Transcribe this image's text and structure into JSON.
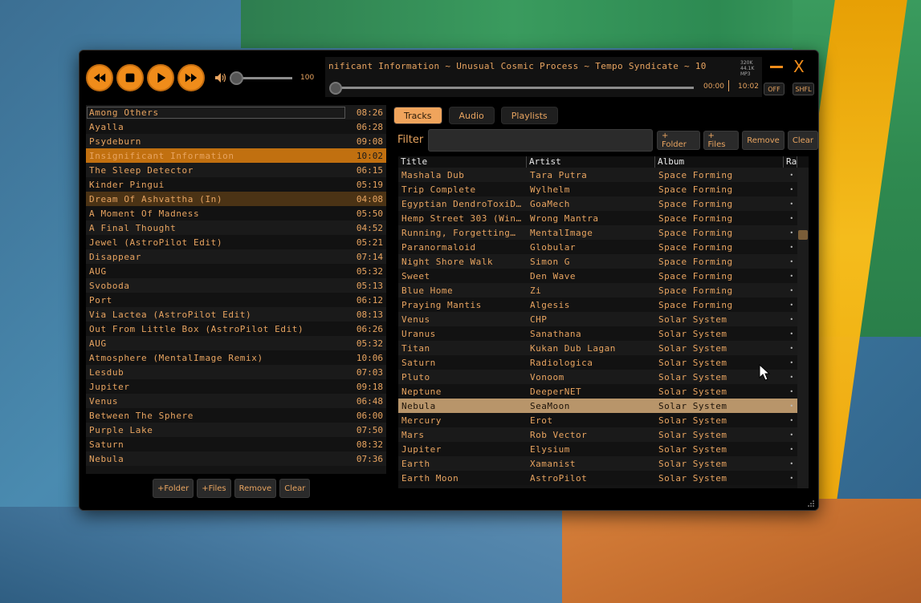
{
  "transport": {
    "volume": "100",
    "now_playing": "nificant Information  ~  Unusual Cosmic Process  ~  Tempo Syndicate  ~  10",
    "format": [
      "320K",
      "44.1K",
      "MP3"
    ],
    "time_current": "00:00",
    "time_total": "10:02",
    "repeat": "OFF",
    "shuffle": "SHFL",
    "close_glyph": "X"
  },
  "playlist": {
    "items": [
      {
        "title": "Among Others",
        "dur": "08:26"
      },
      {
        "title": "Ayalla",
        "dur": "06:28"
      },
      {
        "title": "Psydeburn",
        "dur": "09:08"
      },
      {
        "title": "Insignificant Information",
        "dur": "10:02"
      },
      {
        "title": "The Sleep Detector",
        "dur": "06:15"
      },
      {
        "title": "Kinder Pingui",
        "dur": "05:19"
      },
      {
        "title": "Dream Of Ashvattha (In)",
        "dur": "04:08"
      },
      {
        "title": "A Moment Of Madness",
        "dur": "05:50"
      },
      {
        "title": "A Final Thought",
        "dur": "04:52"
      },
      {
        "title": "Jewel (AstroPilot Edit)",
        "dur": "05:21"
      },
      {
        "title": "Disappear",
        "dur": "07:14"
      },
      {
        "title": "AUG",
        "dur": "05:32"
      },
      {
        "title": "Svoboda",
        "dur": "05:13"
      },
      {
        "title": "Port",
        "dur": "06:12"
      },
      {
        "title": "Via Lactea (AstroPilot Edit)",
        "dur": "08:13"
      },
      {
        "title": "Out From Little Box (AstroPilot Edit)",
        "dur": "06:26"
      },
      {
        "title": "AUG",
        "dur": "05:32"
      },
      {
        "title": "Atmosphere (MentalImage Remix)",
        "dur": "10:06"
      },
      {
        "title": "Lesdub",
        "dur": "07:03"
      },
      {
        "title": "Jupiter",
        "dur": "09:18"
      },
      {
        "title": "Venus",
        "dur": "06:48"
      },
      {
        "title": "Between The Sphere",
        "dur": "06:00"
      },
      {
        "title": "Purple Lake",
        "dur": "07:50"
      },
      {
        "title": "Saturn",
        "dur": "08:32"
      },
      {
        "title": "Nebula",
        "dur": "07:36"
      }
    ],
    "buttons": {
      "folder": "+Folder",
      "files": "+Files",
      "remove": "Remove",
      "clear": "Clear"
    }
  },
  "library": {
    "tabs": [
      "Tracks",
      "Audio",
      "Playlists"
    ],
    "filter_label": "Filter",
    "filter_value": "",
    "buttons": {
      "folder": "+ Folder",
      "files": "+ Files",
      "remove": "Remove",
      "clear": "Clear"
    },
    "columns": [
      "Title",
      "Artist",
      "Album",
      "Ra"
    ],
    "rows": [
      {
        "title": "Mashala Dub",
        "artist": "Tara Putra",
        "album": "Space Forming"
      },
      {
        "title": "Trip Complete",
        "artist": "Wylhelm",
        "album": "Space Forming"
      },
      {
        "title": "Egyptian DendroToxiD…",
        "artist": "GoaMech",
        "album": "Space Forming"
      },
      {
        "title": "Hemp Street 303 (Win…",
        "artist": "Wrong Mantra",
        "album": "Space Forming"
      },
      {
        "title": "Running, Forgetting…",
        "artist": "MentalImage",
        "album": "Space Forming"
      },
      {
        "title": "Paranormaloid",
        "artist": "Globular",
        "album": "Space Forming"
      },
      {
        "title": "Night Shore Walk",
        "artist": "Simon G",
        "album": "Space Forming"
      },
      {
        "title": "Sweet",
        "artist": "Den Wave",
        "album": "Space Forming"
      },
      {
        "title": "Blue Home",
        "artist": "Zi",
        "album": "Space Forming"
      },
      {
        "title": "Praying Mantis",
        "artist": "Algesis",
        "album": "Space Forming"
      },
      {
        "title": "Venus",
        "artist": "CHP",
        "album": "Solar System"
      },
      {
        "title": "Uranus",
        "artist": "Sanathana",
        "album": "Solar System"
      },
      {
        "title": "Titan",
        "artist": "Kukan Dub Lagan",
        "album": "Solar System"
      },
      {
        "title": "Saturn",
        "artist": "Radiologica",
        "album": "Solar System"
      },
      {
        "title": "Pluto",
        "artist": "Vonoom",
        "album": "Solar System"
      },
      {
        "title": "Neptune",
        "artist": "DeeperNET",
        "album": "Solar System"
      },
      {
        "title": "Nebula",
        "artist": "SeaMoon",
        "album": "Solar System"
      },
      {
        "title": "Mercury",
        "artist": "Erot",
        "album": "Solar System"
      },
      {
        "title": "Mars",
        "artist": "Rob Vector",
        "album": "Solar System"
      },
      {
        "title": "Jupiter",
        "artist": "Elysium",
        "album": "Solar System"
      },
      {
        "title": "Earth",
        "artist": "Xamanist",
        "album": "Solar System"
      },
      {
        "title": "Earth Moon",
        "artist": "AstroPilot",
        "album": "Solar System"
      }
    ],
    "rating_glyph": "•"
  },
  "colors": {
    "accent": "#f08c1a",
    "text": "#e8a460",
    "selected_row": "#c17010"
  }
}
